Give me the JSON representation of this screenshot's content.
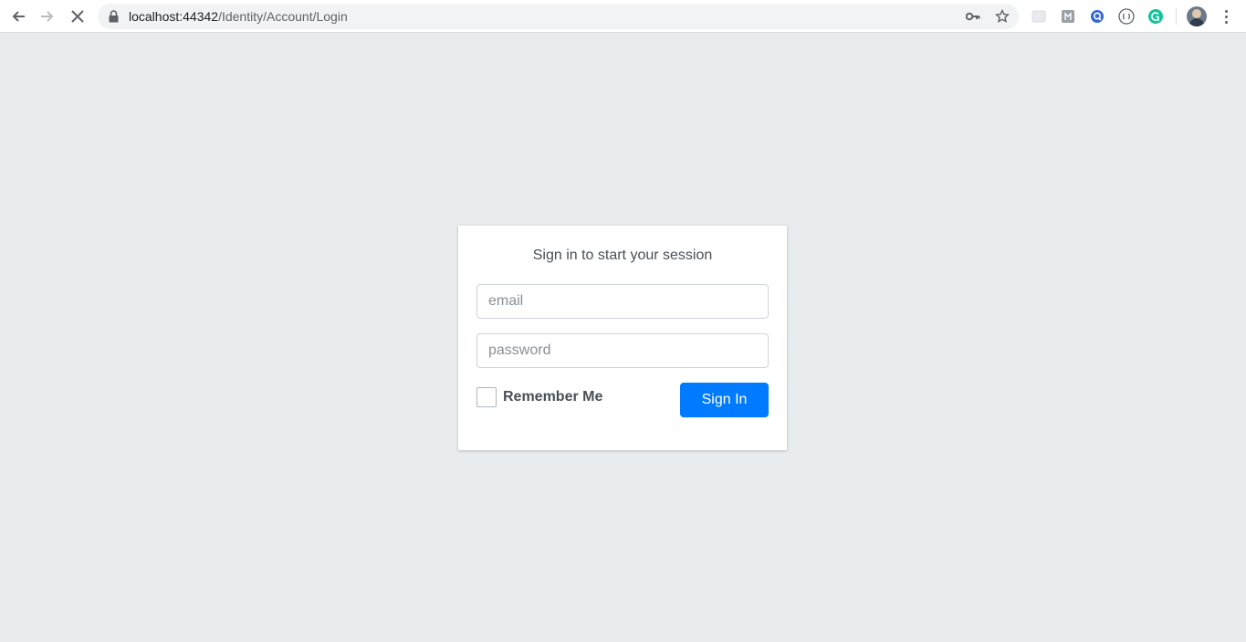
{
  "browser": {
    "url_host": "localhost:44342",
    "url_path": "/Identity/Account/Login",
    "icons": {
      "back": "back-arrow-icon",
      "forward": "forward-arrow-icon",
      "stop": "stop-loading-icon",
      "lock": "lock-icon",
      "key": "key-icon",
      "star": "star-icon",
      "menu": "vertical-dots-icon"
    },
    "extension_colors": [
      "#dadce0",
      "#9aa0a6",
      "#3367d6",
      "#5f6368",
      "#15c39a"
    ]
  },
  "login": {
    "title": "Sign in to start your session",
    "email_placeholder": "email",
    "password_placeholder": "password",
    "remember_label": "Remember Me",
    "remember_checked": false,
    "signin_label": "Sign In",
    "accent_color": "#007bff"
  }
}
